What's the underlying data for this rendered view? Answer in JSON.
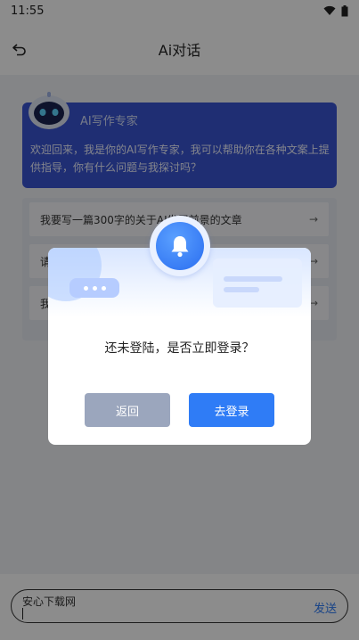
{
  "status_bar": {
    "time": "11:55"
  },
  "nav": {
    "title": "Ai对话"
  },
  "intro": {
    "name": "AI写作专家",
    "text": "欢迎回来，我是你的AI写作专家，我可以帮助你在各种文案上提供指导，你有什么问题与我探讨吗？"
  },
  "suggestions": [
    {
      "label": "我要写一篇300字的关于AI发展前景的文章"
    },
    {
      "label": "请"
    },
    {
      "label": "我"
    }
  ],
  "input": {
    "value": "安心下载网",
    "send_label": "发送"
  },
  "dialog": {
    "message": "还未登陆，是否立即登录？",
    "cancel_label": "返回",
    "confirm_label": "去登录"
  },
  "colors": {
    "accent": "#2f7cf6",
    "card": "#3a55d2",
    "cancel": "#9ba6bd"
  }
}
